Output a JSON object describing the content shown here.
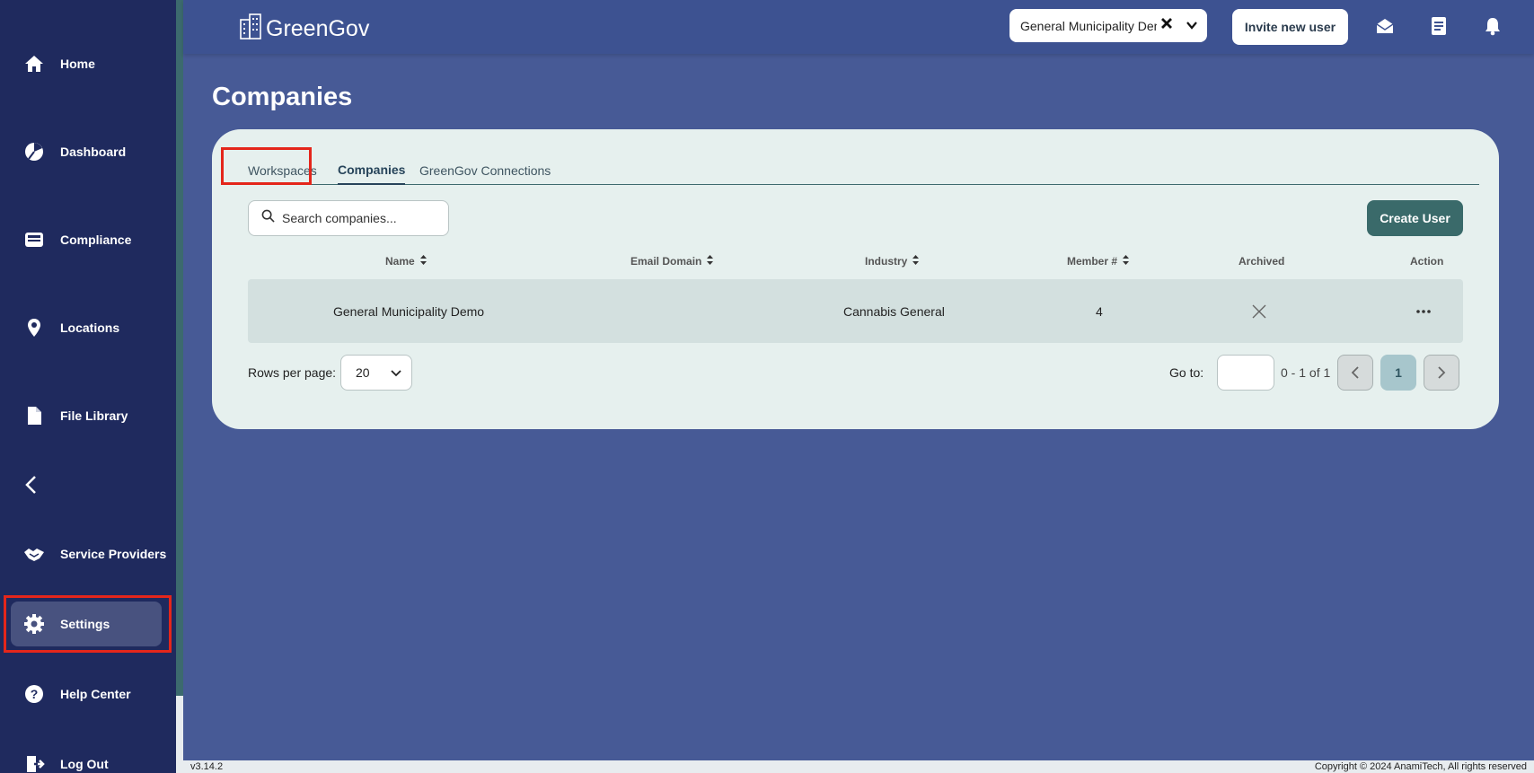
{
  "app": {
    "name": "GreenGov",
    "version": "v3.14.2",
    "copyright": "Copyright © 2024 AnamiTech, All rights reserved"
  },
  "sidebar": {
    "items": [
      {
        "label": "Home",
        "icon": "home-icon"
      },
      {
        "label": "Dashboard",
        "icon": "pie-chart-icon"
      },
      {
        "label": "Compliance",
        "icon": "inbox-icon"
      },
      {
        "label": "Locations",
        "icon": "location-pin-icon"
      },
      {
        "label": "File Library",
        "icon": "file-icon"
      },
      {
        "label": "Service Providers",
        "icon": "handshake-icon"
      },
      {
        "label": "Settings",
        "icon": "gear-icon"
      },
      {
        "label": "Help Center",
        "icon": "help-icon"
      },
      {
        "label": "Log Out",
        "icon": "logout-icon"
      }
    ],
    "active": "Settings"
  },
  "header": {
    "org_select_value": "General Municipality Demo",
    "invite_label": "Invite new user",
    "icons": [
      "mail-icon",
      "document-icon",
      "bell-icon"
    ]
  },
  "page": {
    "title": "Companies"
  },
  "tabs": [
    {
      "label": "Workspaces",
      "active": false
    },
    {
      "label": "Companies",
      "active": true
    },
    {
      "label": "GreenGov Connections",
      "active": false
    }
  ],
  "search": {
    "placeholder": "Search companies..."
  },
  "create_label": "Create User",
  "table": {
    "columns": [
      "Name",
      "Email Domain",
      "Industry",
      "Member #",
      "Archived",
      "Action"
    ],
    "rows": [
      {
        "name": "General Municipality Demo",
        "email_domain": "",
        "industry": "Cannabis General",
        "members": "4",
        "archived": "x-icon",
        "action": "more-icon"
      }
    ]
  },
  "pagination": {
    "rows_label": "Rows per page:",
    "rows_value": "20",
    "goto_label": "Go to:",
    "info": "0 - 1 of 1",
    "current_page": "1"
  },
  "colors": {
    "sidebar": "#1f2a5e",
    "background": "#475a96",
    "card": "#e6f0ee",
    "accent": "#3a6a6a",
    "highlight": "#e4261b"
  }
}
